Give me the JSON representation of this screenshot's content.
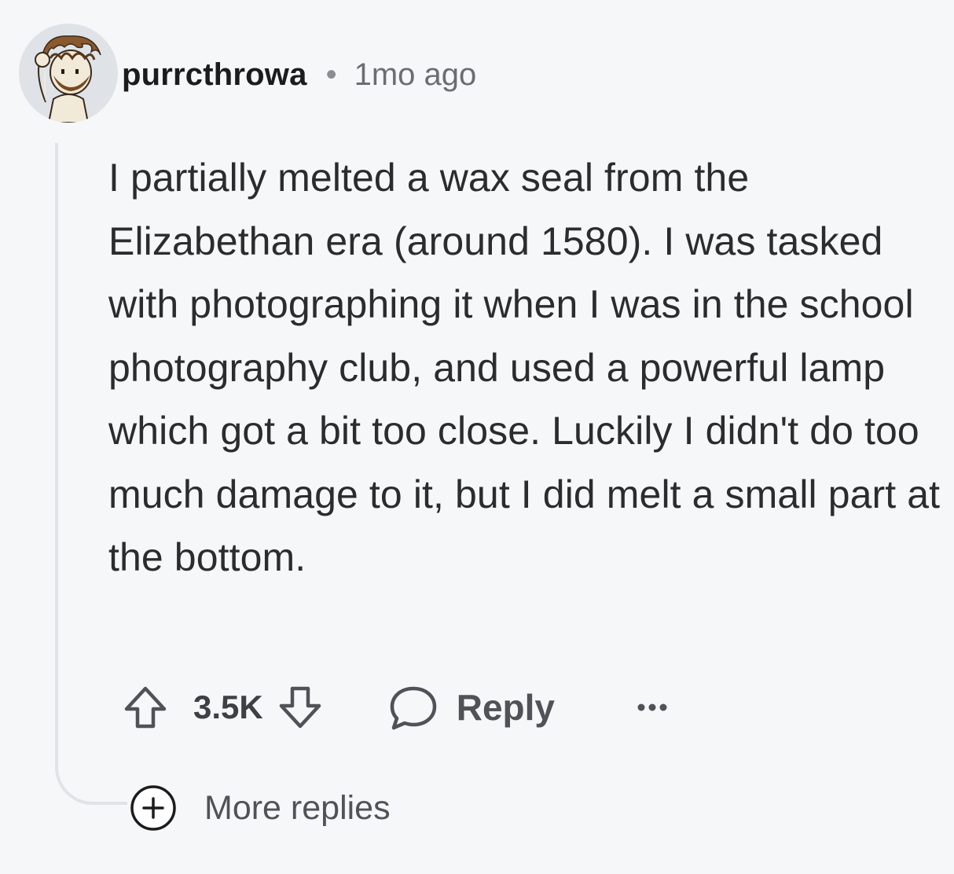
{
  "comment": {
    "username": "purrcthrowa",
    "separator": "•",
    "timestamp": "1mo ago",
    "body": "I partially melted a wax seal from the Elizabethan era (around 1580). I was tasked with photographing it when I was in the school photography club, and used a powerful lamp which got a bit too close. Luckily I didn't do too much damage to it, but I did melt a small part at the bottom.",
    "vote_count": "3.5K",
    "reply_label": "Reply",
    "more_replies_label": "More replies"
  },
  "icons": {
    "avatar": "avatar-icon",
    "upvote": "upvote-arrow-icon",
    "downvote": "downvote-arrow-icon",
    "reply": "speech-bubble-icon",
    "more": "ellipsis-icon",
    "expand": "plus-circle-icon"
  },
  "colors": {
    "background": "#f6f7f8",
    "text": "#1c1c1c",
    "muted": "#6a6e72",
    "thread_line": "#e1e3e6"
  }
}
